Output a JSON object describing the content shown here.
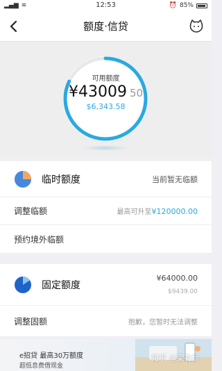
{
  "status_bar": {
    "carrier": "SIM1 SIM2",
    "time": "12:53",
    "battery": "85%"
  },
  "nav": {
    "title": "额度·信贷"
  },
  "hero": {
    "available_label": "可用额度",
    "amount_main": "¥43009",
    "amount_decimal": "50",
    "secondary_amount": "$6,343.58",
    "ring_progress": 0.82
  },
  "temporary": {
    "title": "临时额度",
    "status": "当前暂无临额",
    "adjust_label": "调整临额",
    "adjust_hint_prefix": "最高可升至",
    "adjust_max": "¥120000.00",
    "overseas_label": "预约境外临额"
  },
  "fixed": {
    "title": "固定额度",
    "amount_cny": "¥64000.00",
    "amount_usd": "$9439.00",
    "adjust_label": "调整固额",
    "adjust_status": "抱歉，您暂时无法调整"
  },
  "banner": {
    "line1": "e招贷  最高30万额度",
    "line2": "超低息费借现金",
    "watermark": "知乎 @梁有标"
  },
  "colors": {
    "accent": "#2aa9e0",
    "pie_orange": "#f0a860",
    "pie_blue": "#1e63c8"
  }
}
